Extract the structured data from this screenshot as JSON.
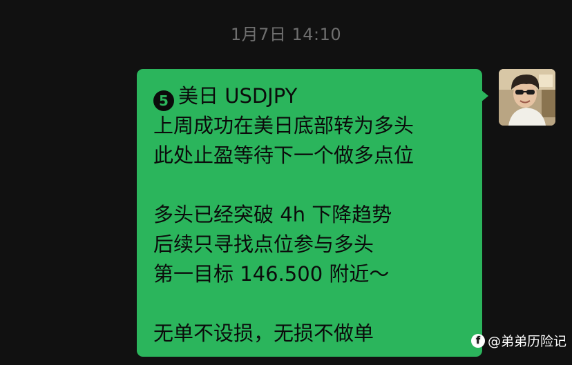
{
  "chat": {
    "timestamp": "1月7日 14:10",
    "message": {
      "badge": "5",
      "lines": [
        "美日 USDJPY",
        "上周成功在美日底部转为多头",
        "此处止盈等待下一个做多点位",
        "",
        "多头已经突破 4h 下降趋势",
        "后续只寻找点位参与多头",
        "第一目标 146.500 附近～",
        "",
        "无单不设损，无损不做单"
      ]
    },
    "avatar_icon": "user-avatar-photo"
  },
  "watermark": {
    "logo_icon": "platform-logo-icon",
    "text": "@弟弟历险记"
  },
  "colors": {
    "background": "#111111",
    "bubble": "#2bb55c",
    "timestamp": "#6f6f6f"
  }
}
